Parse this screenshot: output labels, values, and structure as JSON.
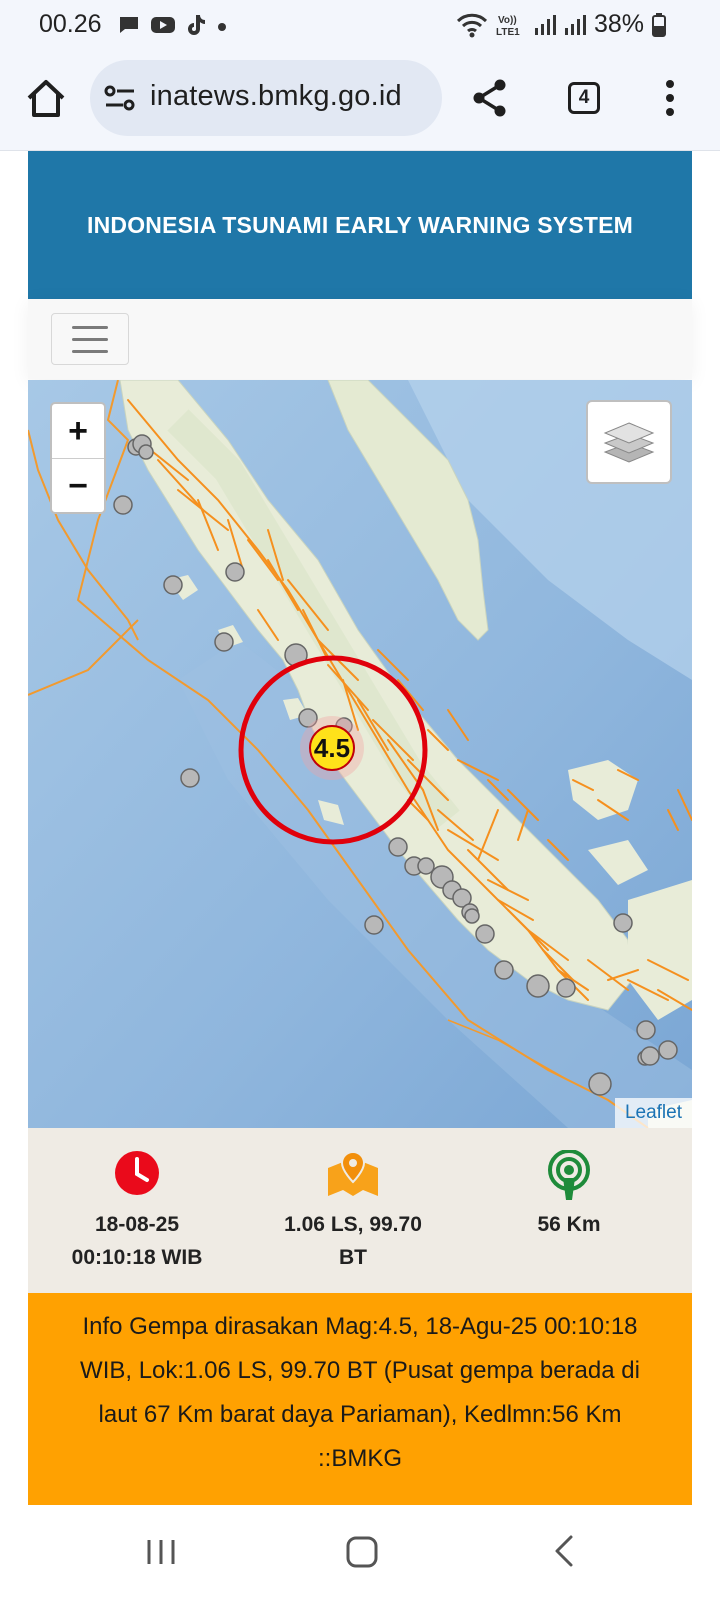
{
  "status_bar": {
    "time": "00.26",
    "battery": "38%",
    "notifications": [
      "chat-icon",
      "youtube-icon",
      "tiktok-icon",
      "dot-icon"
    ],
    "system_icons": [
      "wifi-icon",
      "volte-icon",
      "signal-icon",
      "signal-icon",
      "battery-icon"
    ],
    "volte_label": "Vo)) LTE1"
  },
  "browser": {
    "url": "inatews.bmkg.go.id",
    "tab_count": "4"
  },
  "page": {
    "header_title": "INDONESIA TSUNAMI EARLY WARNING SYSTEM",
    "map": {
      "zoom_in": "+",
      "zoom_out": "−",
      "attribution": "Leaflet",
      "epicenter_magnitude": "4.5"
    },
    "info": {
      "time_line1": "18-08-25",
      "time_line2": "00:10:18 WIB",
      "location_line1": "1.06 LS, 99.70",
      "location_line2": "BT",
      "depth": "56 Km"
    },
    "alert_text": "Info Gempa dirasakan Mag:4.5, 18-Agu-25 00:10:18 WIB, Lok:1.06 LS, 99.70 BT (Pusat gempa berada di laut 67 Km barat daya Pariaman), Kedlmn:56 Km ::BMKG"
  },
  "colors": {
    "header_blue": "#1f77a8",
    "alert_orange": "#ffa101",
    "info_strip": "#efebe4",
    "epicenter_ring": "#e0000b",
    "magnitude_yellow": "#ffe21a",
    "fault_orange": "#f5901e"
  }
}
